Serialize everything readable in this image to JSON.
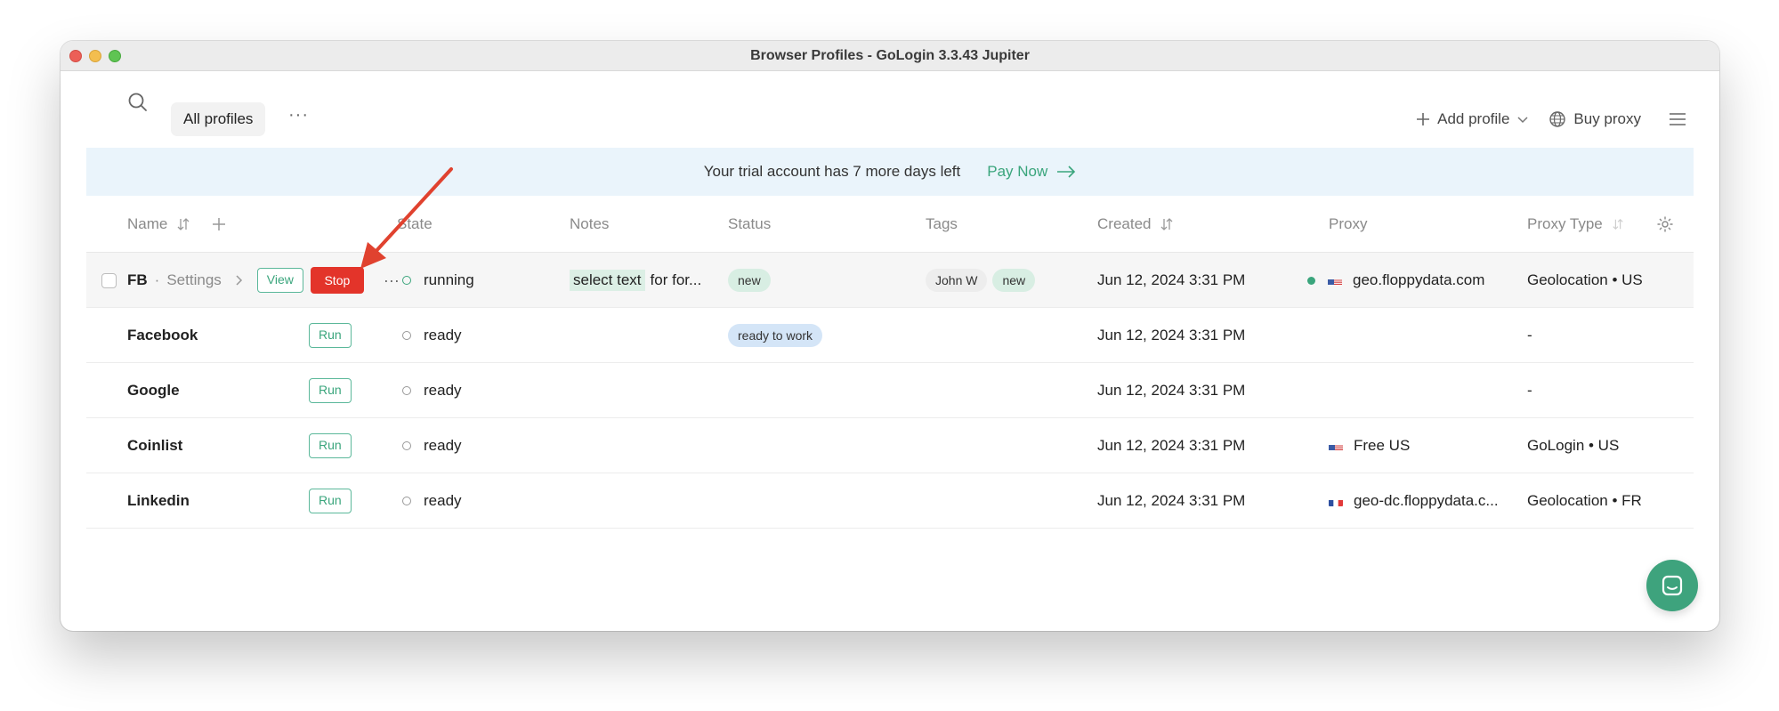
{
  "window": {
    "title": "Browser Profiles - GoLogin 3.3.43 Jupiter"
  },
  "toolbar": {
    "tab_all": "All profiles",
    "more": "···",
    "add_profile": "Add profile",
    "buy_proxy": "Buy proxy"
  },
  "banner": {
    "text": "Your trial account has 7 more days left",
    "pay_now": "Pay Now"
  },
  "columns": {
    "name": "Name",
    "state": "State",
    "notes": "Notes",
    "status": "Status",
    "tags": "Tags",
    "created": "Created",
    "proxy": "Proxy",
    "proxy_type": "Proxy Type"
  },
  "active_row": {
    "name": "FB",
    "settings": "Settings",
    "view": "View",
    "stop": "Stop",
    "more": "···",
    "state": "running",
    "note_highlight": "select text",
    "note_rest": "for for...",
    "status": "new",
    "tags": [
      "John W",
      "new"
    ],
    "created": "Jun 12, 2024 3:31 PM",
    "proxy": "geo.floppydata.com",
    "proxy_type": "Geolocation • US"
  },
  "rows": [
    {
      "name": "Facebook",
      "run": "Run",
      "state": "ready",
      "status": "ready to work",
      "created": "Jun 12, 2024 3:31 PM",
      "proxy": "",
      "proxy_type": "-"
    },
    {
      "name": "Google",
      "run": "Run",
      "state": "ready",
      "status": "",
      "created": "Jun 12, 2024 3:31 PM",
      "proxy": "",
      "proxy_type": "-"
    },
    {
      "name": "Coinlist",
      "run": "Run",
      "state": "ready",
      "status": "",
      "created": "Jun 12, 2024 3:31 PM",
      "proxy": "Free US",
      "proxy_type": "GoLogin • US"
    },
    {
      "name": "Linkedin",
      "run": "Run",
      "state": "ready",
      "status": "",
      "created": "Jun 12, 2024 3:31 PM",
      "proxy": "geo-dc.floppydata.c...",
      "proxy_type": "Geolocation • FR"
    }
  ],
  "colors": {
    "accent": "#3aa57c",
    "stop": "#e3342a",
    "banner_bg": "#eaf4fb",
    "arrow": "#e0422f"
  }
}
